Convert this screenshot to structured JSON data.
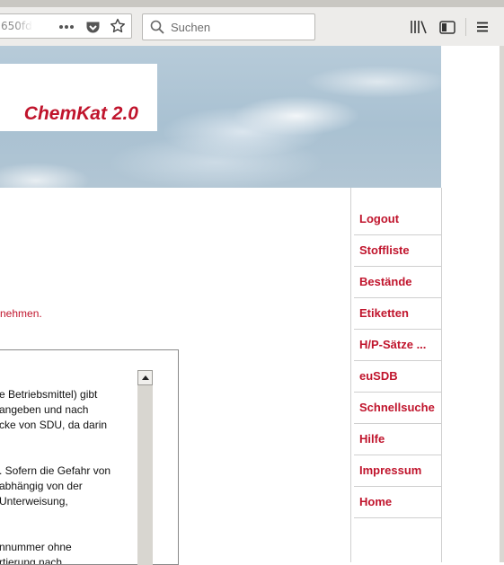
{
  "browser": {
    "url_fragment": "650fd",
    "search_placeholder": "Suchen",
    "icons": [
      "more-icon",
      "pocket-icon",
      "bookmark-star-icon",
      "search-icon",
      "library-icon",
      "sidebar-icon",
      "menu-icon"
    ]
  },
  "header": {
    "logo": "ChemKat 2.0"
  },
  "nav": {
    "items": [
      "Logout",
      "Stoffliste",
      "Bestände",
      "Etiketten",
      "H/P-Sätze ...",
      "euSDB",
      "Schnellsuche",
      "Hilfe",
      "Impressum",
      "Home"
    ]
  },
  "main": {
    "notice": "nehmen.",
    "textbox_lines": [
      "e Betriebsmittel) gibt",
      "angeben und nach",
      "cke von SDU, da darin",
      ". Sofern die Gefahr von",
      "abhängig von der",
      "Unterweisung,",
      "nnummer ohne",
      "rtierung nach"
    ]
  },
  "colors": {
    "accent": "#c0142c",
    "chrome": "#edecea"
  }
}
